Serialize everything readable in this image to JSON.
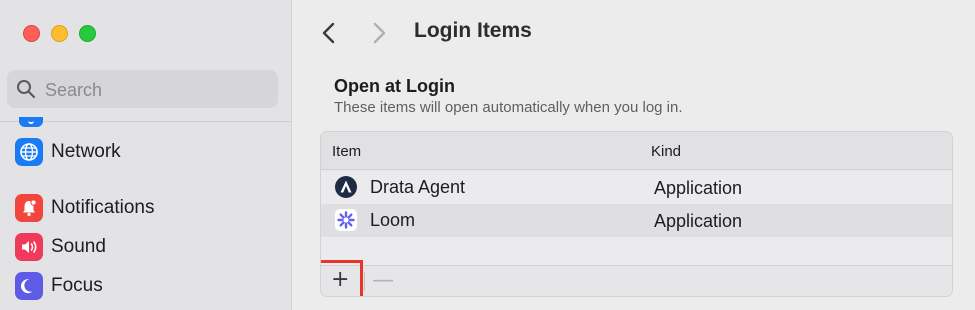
{
  "sidebar": {
    "search": {
      "placeholder": "Search"
    },
    "items": [
      {
        "label": "Network",
        "icon": "globe-icon",
        "color": "#1a7cf5"
      },
      {
        "label": "Notifications",
        "icon": "bell-icon",
        "color": "#f2453d"
      },
      {
        "label": "Sound",
        "icon": "speaker-icon",
        "color": "#f03a5a"
      },
      {
        "label": "Focus",
        "icon": "moon-icon",
        "color": "#5e5ce6"
      }
    ]
  },
  "header": {
    "title": "Login Items"
  },
  "section": {
    "title": "Open at Login",
    "subtitle": "These items will open automatically when you log in."
  },
  "table": {
    "columns": [
      "Item",
      "Kind"
    ],
    "rows": [
      {
        "name": "Drata Agent",
        "kind": "Application",
        "icon": "drata-agent-icon"
      },
      {
        "name": "Loom",
        "kind": "Application",
        "icon": "loom-icon"
      }
    ]
  },
  "controls": {
    "add_label": "+",
    "remove_label": "—"
  }
}
